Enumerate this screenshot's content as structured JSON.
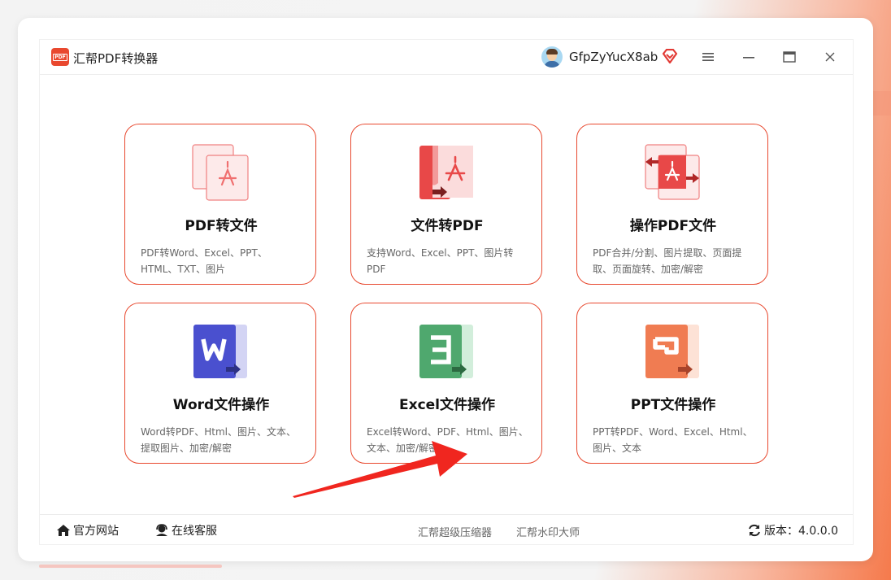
{
  "app": {
    "title": "汇帮PDF转换器",
    "logo_text": "PDF"
  },
  "user": {
    "name": "GfpZyYucX8ab"
  },
  "cards": [
    {
      "title": "PDF转文件",
      "desc": "PDF转Word、Excel、PPT、HTML、TXT、图片"
    },
    {
      "title": "文件转PDF",
      "desc": "支持Word、Excel、PPT、图片转PDF"
    },
    {
      "title": "操作PDF文件",
      "desc": "PDF合并/分割、图片提取、页面提取、页面旋转、加密/解密"
    },
    {
      "title": "Word文件操作",
      "desc": "Word转PDF、Html、图片、文本、提取图片、加密/解密"
    },
    {
      "title": "Excel文件操作",
      "desc": "Excel转Word、PDF、Html、图片、文本、加密/解密"
    },
    {
      "title": "PPT文件操作",
      "desc": "PPT转PDF、Word、Excel、Html、图片、文本"
    }
  ],
  "footer": {
    "website": "官方网站",
    "support": "在线客服",
    "compressor": "汇帮超级压缩器",
    "watermark": "汇帮水印大师",
    "version": "版本：4.0.0.0"
  },
  "colors": {
    "accent": "#e8492f",
    "word": "#4a50cf",
    "excel": "#4fa86e",
    "ppt": "#f07c52"
  }
}
